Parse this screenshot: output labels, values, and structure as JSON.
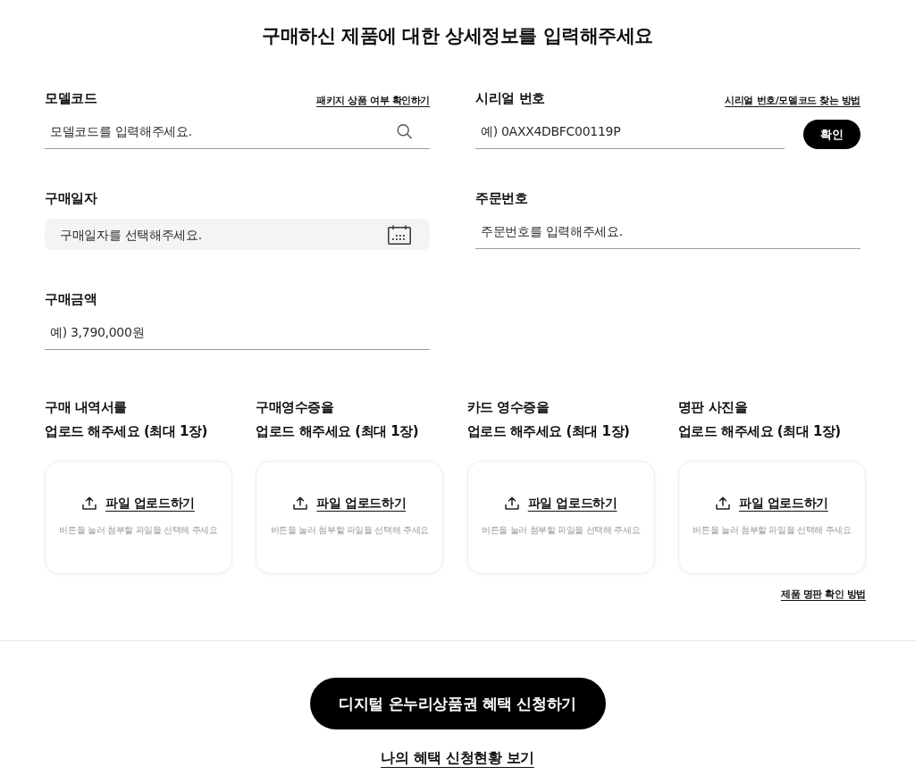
{
  "title": "구매하신 제품에 대한 상세정보를 입력해주세요",
  "fields": [
    {
      "kind": "search",
      "label": "모델코드",
      "link": "패키지 상품 여부 확인하기",
      "placeholder": "모델코드를 입력해주세요."
    },
    {
      "kind": "verify",
      "label": "시리얼 번호",
      "link": "시리얼 번호/모델코드 찾는 방법",
      "placeholder": "예) 0AXX4DBFC00119P",
      "button": "확인"
    },
    {
      "kind": "date",
      "label": "구매일자",
      "placeholder": "구매일자를 선택해주세요."
    },
    {
      "kind": "text",
      "label": "주문번호",
      "placeholder": "주문번호를 입력해주세요."
    },
    {
      "kind": "text",
      "label": "구매금액",
      "placeholder": "예) 3,790,000원"
    }
  ],
  "uploads": [
    {
      "heading": [
        "구매 내역서를",
        "업로드 해주세요 (최대 1장)"
      ],
      "button": "파일 업로드하기",
      "hint": "버튼을 눌러 첨부할 파일을 선택해 주세요"
    },
    {
      "heading": [
        "구매영수증을",
        "업로드 해주세요 (최대 1장)"
      ],
      "button": "파일 업로드하기",
      "hint": "버튼을 눌러 첨부할 파일을 선택해 주세요"
    },
    {
      "heading": [
        "카드 영수증을",
        "업로드 해주세요 (최대 1장)"
      ],
      "button": "파일 업로드하기",
      "hint": "버튼을 눌러 첨부할 파일을 선택해 주세요"
    },
    {
      "heading": [
        "명판 사진을",
        "업로드 해주세요 (최대 1장)"
      ],
      "button": "파일 업로드하기",
      "hint": "버튼을 눌러 첨부할 파일을 선택해 주세요"
    }
  ],
  "uploads_link": "제품 명판 확인 방법",
  "submit_button": "디지털 온누리상품권 혜택 신청하기",
  "status_link": "나의 혜택 신청현황 보기"
}
